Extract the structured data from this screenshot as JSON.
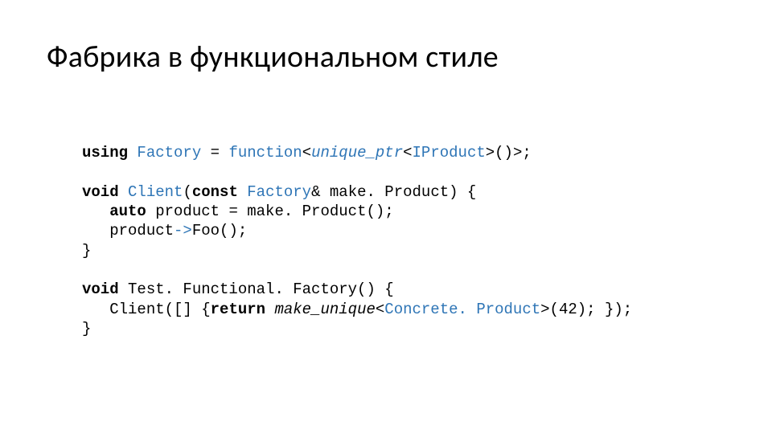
{
  "title": "Фабрика в функциональном стиле",
  "code": {
    "l01": {
      "kw_using": "using",
      "factory": "Factory",
      "eq": " = ",
      "func": "function",
      "lt1": "<",
      "uptr": "unique_ptr",
      "lt2": "<",
      "iprod": "IProduct",
      "gt2": ">",
      "sig": "()>;",
      "gt1_close": ""
    },
    "l02": "",
    "l03": {
      "kw_void": "void",
      "sp": " ",
      "client": "Client",
      "op": "(",
      "kw_const": "const",
      "sp2": " ",
      "factory": "Factory",
      "amp": "& make. Product) {"
    },
    "l04": {
      "indent": "   ",
      "kw_auto": "auto",
      "rest": " product = make. Product();"
    },
    "l05": {
      "indent": "   product",
      "arrow": "->",
      "foo": "Foo();"
    },
    "l06": "}",
    "l07": "",
    "l08": {
      "kw_void": "void",
      "sp": " ",
      "name": "Test. Functional. Factory() {"
    },
    "l09": {
      "indent": "   Client([] {",
      "kw_ret": "return",
      "sp": " ",
      "mu": "make_unique",
      "lt": "<",
      "cp": "Concrete. Product",
      "gt": ">(42); });"
    },
    "l10": "}"
  }
}
